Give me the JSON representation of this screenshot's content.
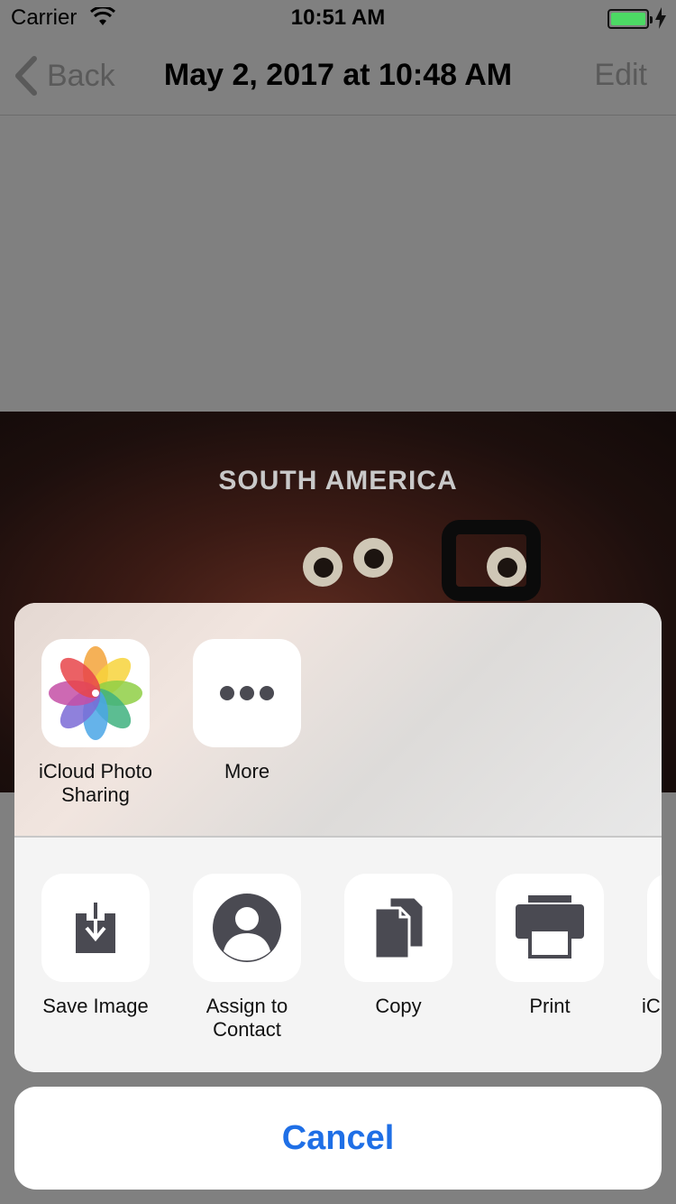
{
  "status_bar": {
    "carrier": "Carrier",
    "time": "10:51 AM",
    "battery_color": "#4cd964"
  },
  "nav_bar": {
    "back_label": "Back",
    "title": "May 2, 2017 at 10:48 AM",
    "edit_label": "Edit"
  },
  "photo": {
    "caption": "SOUTH AMERICA"
  },
  "share_sheet": {
    "apps": [
      {
        "label": "iCloud Photo Sharing",
        "icon": "photos-icon"
      },
      {
        "label": "More",
        "icon": "more-icon"
      }
    ],
    "actions": [
      {
        "label": "Save Image",
        "icon": "save-image-icon"
      },
      {
        "label": "Assign to Contact",
        "icon": "contact-icon"
      },
      {
        "label": "Copy",
        "icon": "copy-icon"
      },
      {
        "label": "Print",
        "icon": "print-icon"
      },
      {
        "label": "iC",
        "icon": "partial-action-icon"
      }
    ]
  },
  "cancel": {
    "label": "Cancel",
    "color": "#1f6fe6"
  }
}
